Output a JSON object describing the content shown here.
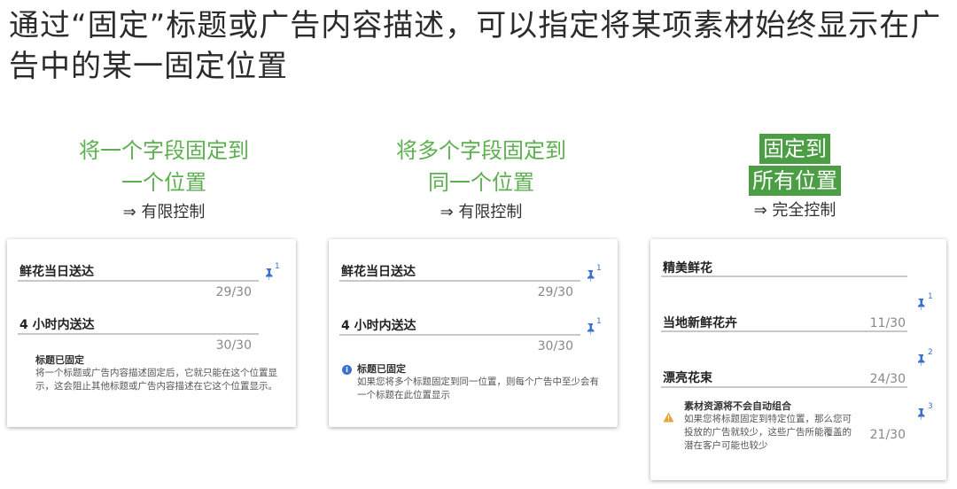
{
  "title": "通过“固定”标题或广告内容描述，可以指定将某项素材始终显示在广告中的某一固定位置",
  "columns": [
    {
      "line1": "将一个字段固定到",
      "line2": "一个位置",
      "sub": "⇒ 有限控制"
    },
    {
      "line1": "将多个字段固定到",
      "line2": "同一个位置",
      "sub": "⇒ 有限控制"
    },
    {
      "line1": "固定到",
      "line2": "所有位置",
      "sub": "⇒ 完全控制"
    }
  ],
  "card1": {
    "field1": "鲜花当日送达",
    "count1": "29/30",
    "pin1_sup": "1",
    "field2": "4 小时内送达",
    "count2": "30/30",
    "note_title": "标题已固定",
    "note_body": "将一个标题或广告内容描述固定后，它就只能在这个位置显示，这会阻止其他标题或广告内容描述在它这个位置显示。"
  },
  "card2": {
    "field1": "鲜花当日送达",
    "count1": "29/30",
    "pin1_sup": "1",
    "field2": "4 小时内送达",
    "count2": "30/30",
    "pin2_sup": "1",
    "note_title": "标题已固定",
    "note_body": "如果您将多个标题固定到同一位置，则每个广告中至少会有一个标题在此位置显示"
  },
  "card3": {
    "field1": "精美鲜花",
    "pin1_sup": "1",
    "field2": "当地新鲜花卉",
    "count2": "11/30",
    "pin2_sup": "2",
    "field3": "漂亮花束",
    "count3": "24/30",
    "pin3_sup": "3",
    "count4": "21/30",
    "note_title": "素材资源将不会自动组合",
    "note_body": "如果您将标题固定到特定位置，那么您可投放的广告就较少，这些广告所能覆盖的潜在客户可能也较少"
  },
  "colors": {
    "accent_green": "#5cb04f",
    "highlight_green": "#4c9e45",
    "pin_blue": "#3b6fd1",
    "warning": "#e8a33a"
  },
  "icons": {
    "pin": "pin-icon",
    "info": "info-icon",
    "warning": "warning-icon"
  }
}
